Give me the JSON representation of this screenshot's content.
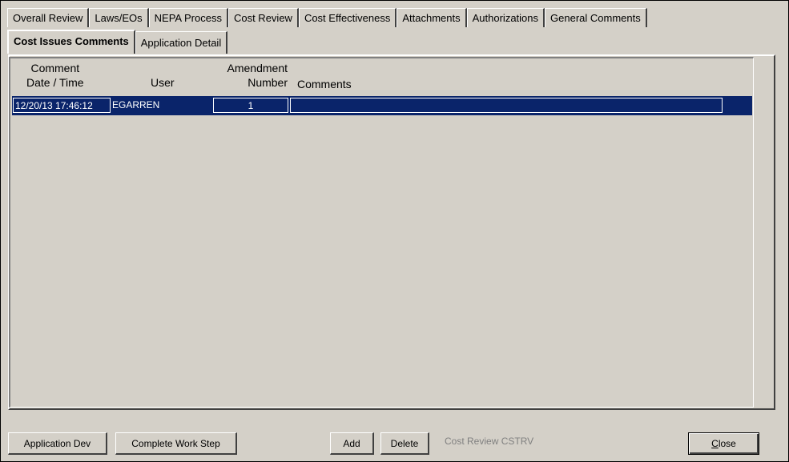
{
  "tabs_row1": [
    {
      "label": "Overall Review"
    },
    {
      "label": "Laws/EOs"
    },
    {
      "label": "NEPA Process"
    },
    {
      "label": "Cost Review"
    },
    {
      "label": "Cost Effectiveness"
    },
    {
      "label": "Attachments"
    },
    {
      "label": "Authorizations"
    },
    {
      "label": "General Comments"
    }
  ],
  "tabs_row2": [
    {
      "label": "Cost Issues Comments",
      "active": true
    },
    {
      "label": "Application Detail"
    }
  ],
  "grid": {
    "headers": {
      "comment_line1": "Comment",
      "comment_line2": "Date / Time",
      "user": "User",
      "amendment_line1": "Amendment",
      "amendment_line2": "Number",
      "comments": "Comments"
    },
    "rows": [
      {
        "datetime": "12/20/13 17:46:12",
        "user": "EGARREN",
        "amendment": "1",
        "comments": ""
      }
    ]
  },
  "buttons": {
    "application_dev": "Application Dev",
    "complete_work_step": "Complete Work Step",
    "add": "Add",
    "delete": "Delete",
    "close_prefix": "C",
    "close_rest": "lose"
  },
  "status_text": "Cost Review  CSTRV",
  "colors": {
    "window_bg": "#d4d0c8",
    "selection": "#0a246a"
  }
}
